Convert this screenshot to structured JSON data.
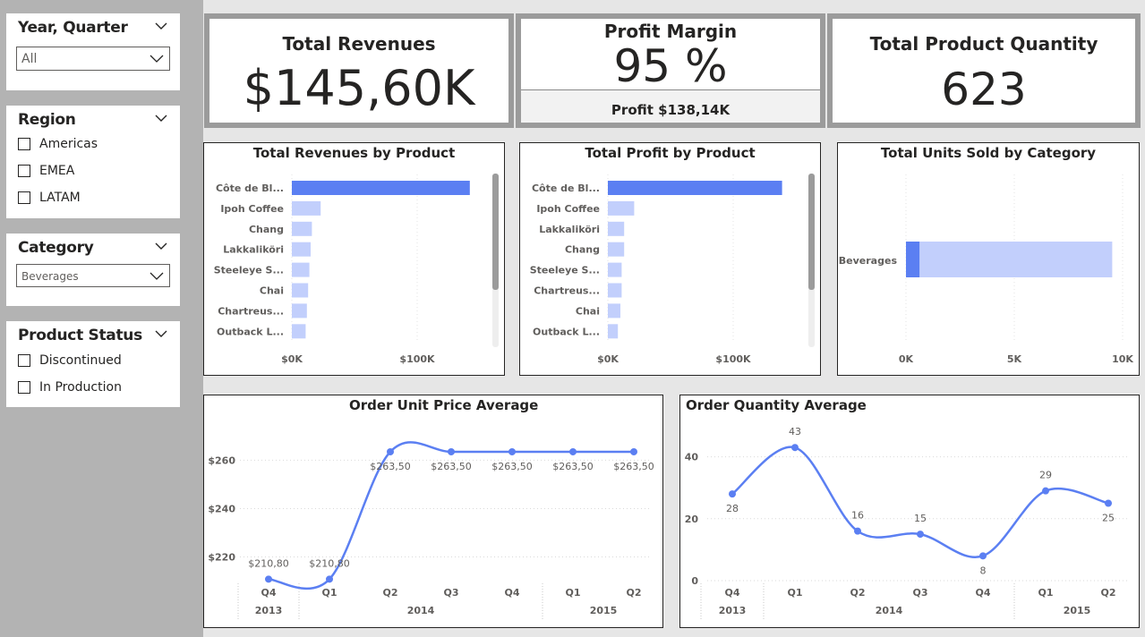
{
  "slicers": {
    "year_quarter": {
      "title": "Year, Quarter",
      "value": "All"
    },
    "region": {
      "title": "Region",
      "options": [
        "Americas",
        "EMEA",
        "LATAM"
      ]
    },
    "category": {
      "title": "Category",
      "value": "Beverages"
    },
    "product_status": {
      "title": "Product Status",
      "options": [
        "Discontinued",
        "In Production"
      ]
    }
  },
  "cards": {
    "total_revenues": {
      "title": "Total Revenues",
      "value": "$145,60K"
    },
    "profit_margin": {
      "title": "Profit Margin",
      "value": "95 %",
      "sub": "Profit $138,14K"
    },
    "total_quantity": {
      "title": "Total Product Quantity",
      "value": "623"
    }
  },
  "colors": {
    "accent": "#5b7ff2",
    "light": "#c2cffc",
    "frame": "#9b9b9b"
  },
  "chart_data": [
    {
      "type": "bar",
      "title": "Total Revenues by Product",
      "categories": [
        "Côte de Bl...",
        "Ipoh Coffee",
        "Chang",
        "Lakkaliköri",
        "Steeleye S...",
        "Chai",
        "Chartreus...",
        "Outback L..."
      ],
      "values": [
        142,
        23,
        16,
        15,
        14,
        13,
        12,
        11
      ],
      "ticks": [
        "$0K",
        "$100K"
      ],
      "xlim": [
        0,
        150
      ]
    },
    {
      "type": "bar",
      "title": "Total Profit by Product",
      "categories": [
        "Côte de Bl...",
        "Ipoh Coffee",
        "Lakkaliköri",
        "Chang",
        "Steeleye S...",
        "Chartreus...",
        "Chai",
        "Outback L..."
      ],
      "values": [
        139,
        21,
        13,
        13,
        11,
        11,
        10,
        8
      ],
      "ticks": [
        "$0K",
        "$100K"
      ],
      "xlim": [
        0,
        150
      ]
    },
    {
      "type": "bar",
      "title": "Total Units Sold by Category",
      "categories": [
        "Beverages"
      ],
      "series": [
        {
          "values": [
            623
          ]
        },
        {
          "values": [
            9520
          ]
        }
      ],
      "ticks": [
        "0K",
        "5K",
        "10K"
      ],
      "xlim": [
        0,
        10000
      ]
    },
    {
      "type": "line",
      "title": "Order Unit Price Average",
      "x": [
        "Q4",
        "Q1",
        "Q2",
        "Q3",
        "Q4",
        "Q1",
        "Q2"
      ],
      "years": [
        "2013",
        "2014",
        "2015"
      ],
      "values": [
        210.8,
        210.8,
        263.5,
        263.5,
        263.5,
        263.5,
        263.5
      ],
      "labels": [
        "$210,80",
        "$210,80",
        "$263,50",
        "$263,50",
        "$263,50",
        "$263,50",
        "$263,50"
      ],
      "yticks": [
        "$220",
        "$240",
        "$260"
      ],
      "ylim": [
        205,
        272
      ]
    },
    {
      "type": "line",
      "title": "Order Quantity Average",
      "x": [
        "Q4",
        "Q1",
        "Q2",
        "Q3",
        "Q4",
        "Q1",
        "Q2"
      ],
      "years": [
        "2013",
        "2014",
        "2015"
      ],
      "values": [
        28,
        43,
        16,
        15,
        8,
        29,
        25
      ],
      "labels": [
        "28",
        "43",
        "16",
        "15",
        "8",
        "29",
        "25"
      ],
      "yticks": [
        "0",
        "20",
        "40"
      ],
      "ylim": [
        0,
        50
      ]
    }
  ]
}
